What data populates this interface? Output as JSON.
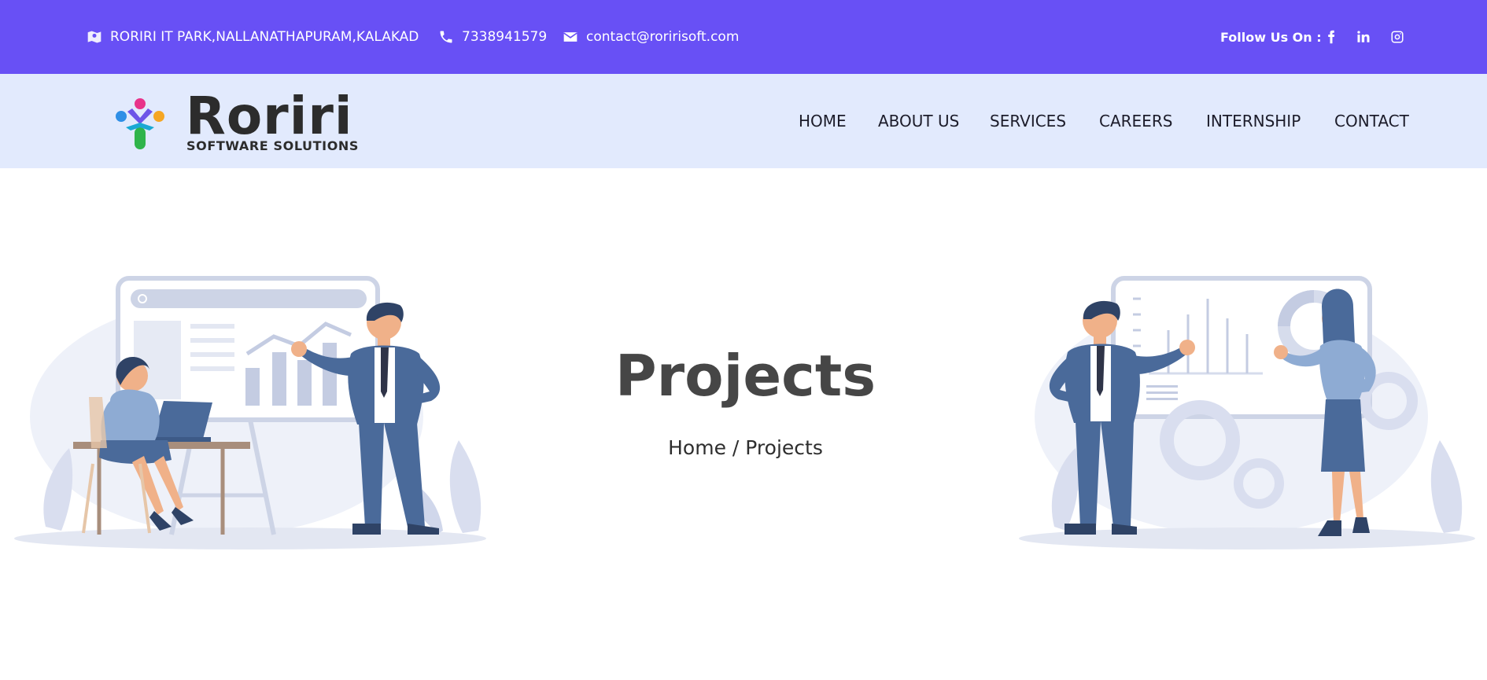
{
  "topbar": {
    "address": "RORIRI IT PARK,NALLANATHAPURAM,KALAKAD",
    "phone": "7338941579",
    "email": "contact@roririsoft.com",
    "follow_label": "Follow Us On :",
    "social": [
      "facebook-icon",
      "linkedin-icon",
      "instagram-icon"
    ]
  },
  "logo": {
    "name": "Roriri",
    "tagline": "SOFTWARE SOLUTIONS"
  },
  "nav": {
    "items": [
      "HOME",
      "ABOUT US",
      "SERVICES",
      "CAREERS",
      "INTERNSHIP",
      "CONTACT"
    ]
  },
  "hero": {
    "title": "Projects",
    "breadcrumb_home": "Home",
    "breadcrumb_sep": "/",
    "breadcrumb_current": "Projects"
  },
  "colors": {
    "topbar": "#6850f5",
    "navbar": "#e2eafd",
    "illustration_blue": "#4a6a9a",
    "illustration_light": "#eef1f9"
  }
}
